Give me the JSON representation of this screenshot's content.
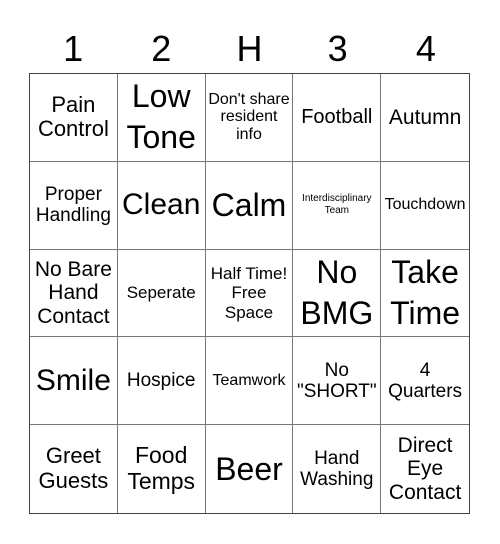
{
  "header": [
    "1",
    "2",
    "H",
    "3",
    "4"
  ],
  "cells": [
    [
      "Pain Control",
      "Low Tone",
      "Don't share resident info",
      "Football",
      "Autumn"
    ],
    [
      "Proper Handling",
      "Clean",
      "Calm",
      "Interdisciplinary Team",
      "Touchdown"
    ],
    [
      "No Bare Hand Contact",
      "Seperate",
      "Half Time! Free Space",
      "No BMG",
      "Take Time"
    ],
    [
      "Smile",
      "Hospice",
      "Teamwork",
      "No \"SHORT\"",
      "4 Quarters"
    ],
    [
      "Greet Guests",
      "Food Temps",
      "Beer",
      "Hand Washing",
      "Direct Eye Contact"
    ]
  ]
}
